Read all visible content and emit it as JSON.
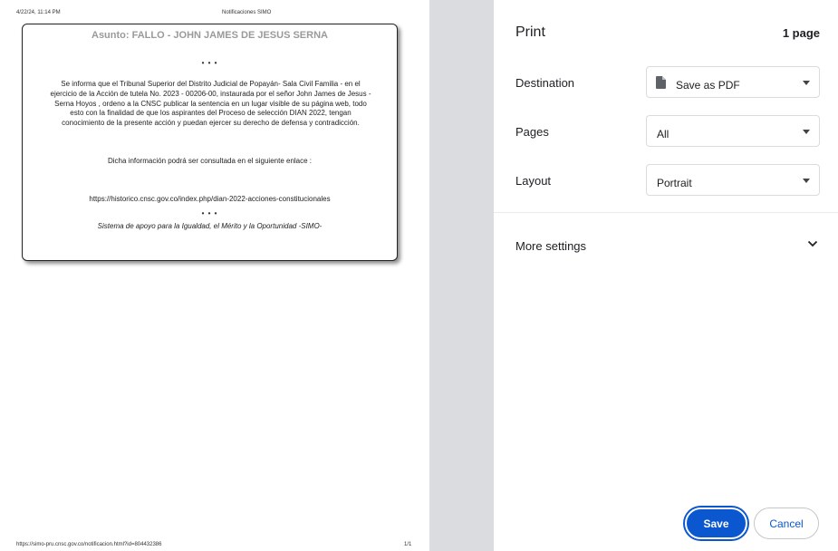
{
  "preview": {
    "header_date": "4/22/24, 11:14 PM",
    "header_title": "Notificaciones SIMO",
    "footer_url": "https://simo-pru.cnsc.gov.co/notificacion.html?id=804432386",
    "footer_page": "1/1",
    "card": {
      "title": "Asunto: FALLO - JOHN JAMES DE JESUS SERNA",
      "dots": "• • •",
      "body": "Se informa que el Tribunal Superior del Distrito Judicial de Popayán- Sala Civil Familia - en el ejercicio de la Acción de tutela No. 2023 - 00206-00, instaurada por el señor John James de Jesus - Serna Hoyos , ordeno a la CNSC publicar la sentencia en un lugar visible de su página web, todo esto con la finalidad de que los aspirantes del Proceso de selección DIAN 2022, tengan conocimiento de la presente acción y puedan ejercer su derecho de defensa y contradicción.",
      "info": "Dicha información podrá ser consultada en el siguiente enlace :",
      "link": "https://historico.cnsc.gov.co/index.php/dian-2022-acciones-constitucionales",
      "footer": "Sistema de apoyo para la Igualdad, el Mérito y la Oportunidad -SIMO-"
    }
  },
  "panel": {
    "title": "Print",
    "page_count": "1 page",
    "destination_label": "Destination",
    "destination_value": "Save as PDF",
    "pages_label": "Pages",
    "pages_value": "All",
    "layout_label": "Layout",
    "layout_value": "Portrait",
    "more_settings": "More settings",
    "save_label": "Save",
    "cancel_label": "Cancel"
  },
  "colors": {
    "accent": "#0b57d0",
    "preview_bg": "#dadce0"
  }
}
